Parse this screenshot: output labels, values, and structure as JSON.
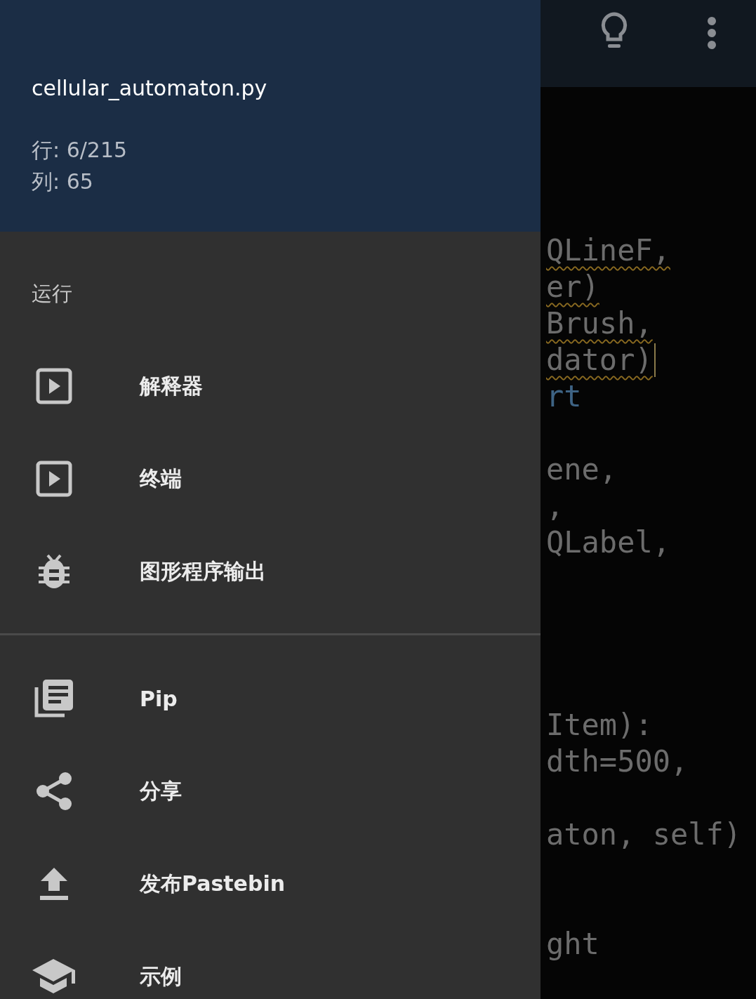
{
  "drawer": {
    "file_name": "cellular_automaton.py",
    "line_info": "行: 6/215",
    "column_info": "列: 65",
    "sections": [
      {
        "title": "运行",
        "items": [
          {
            "label": "解释器",
            "kind": "run"
          },
          {
            "label": "终端",
            "kind": "run"
          },
          {
            "label": "图形程序输出",
            "kind": "debug"
          }
        ]
      },
      {
        "items": [
          {
            "label": "Pip",
            "kind": "packages"
          },
          {
            "label": "分享",
            "kind": "share"
          },
          {
            "label": "发布Pastebin",
            "kind": "upload"
          },
          {
            "label": "示例",
            "kind": "examples"
          }
        ]
      }
    ]
  },
  "editor": {
    "lines": [
      {
        "text": "QLineF,",
        "kind": "warning"
      },
      {
        "text": "er)",
        "kind": "warning"
      },
      {
        "text": "Brush,",
        "kind": "warning"
      },
      {
        "text": "dator)",
        "kind": "warning",
        "cursor": true
      },
      {
        "text": "rt",
        "kind": "keyword"
      },
      {
        "text": "ene,",
        "kind": "plain"
      },
      {
        "text": ",",
        "kind": "plain"
      },
      {
        "text": "QLabel,",
        "kind": "plain"
      },
      {
        "text": "Item):",
        "kind": "plain"
      },
      {
        "text": "dth=500,",
        "kind": "plain"
      },
      {
        "text": "aton, self)",
        "kind": "plain"
      },
      {
        "text": "ght",
        "kind": "plain"
      }
    ]
  }
}
